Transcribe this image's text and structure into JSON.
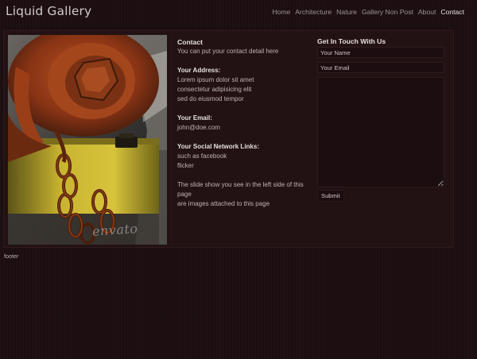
{
  "site": {
    "title": "Liquid Gallery"
  },
  "nav": {
    "items": [
      {
        "label": "Home"
      },
      {
        "label": "Architecture"
      },
      {
        "label": "Nature"
      },
      {
        "label": "Gallery Non Post"
      },
      {
        "label": "About"
      },
      {
        "label": "Contact",
        "active": true
      }
    ]
  },
  "photo": {
    "watermark": "envato"
  },
  "contact": {
    "title": "Contact",
    "intro": "You can  put your contact detail here",
    "address_heading": "Your Address:",
    "address_lines": [
      "Lorem ipsum dolor sit amet",
      "consectetur adipisicing elit",
      "sed do eiusmod tempor"
    ],
    "email_heading": "Your Email:",
    "email": "john@doe.com",
    "social_heading": "Your Social Network Links:",
    "social_lines": [
      " such as facebook",
      " flicker"
    ],
    "note_lines": [
      "The slide show you see in the left side of this page",
      "are images attached to this page"
    ]
  },
  "form": {
    "title": "Get In Touch With Us",
    "name_placeholder": "Your Name",
    "email_placeholder": "Your Email",
    "submit_label": "Submit"
  },
  "footer": {
    "text": "footer"
  },
  "colors": {
    "background": "#1c0e10",
    "panel": "#231214",
    "text": "#bcb3b3",
    "active": "#e6dfdf"
  }
}
